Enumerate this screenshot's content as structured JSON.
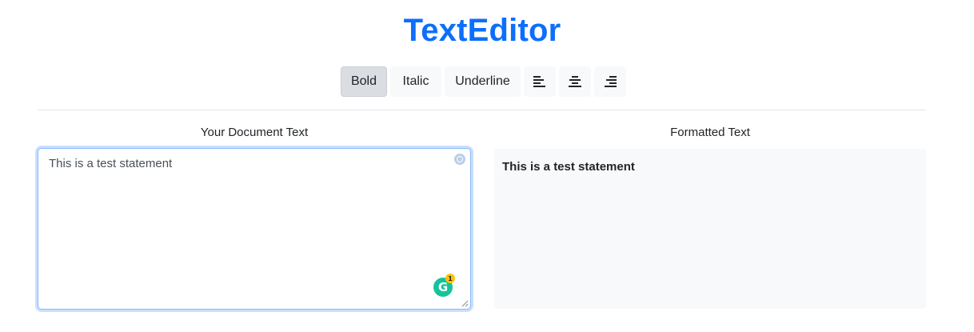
{
  "app": {
    "title": "TextEditor"
  },
  "toolbar": {
    "bold_label": "Bold",
    "italic_label": "Italic",
    "underline_label": "Underline",
    "align_left_icon": "align-left-icon",
    "align_center_icon": "align-center-icon",
    "align_right_icon": "align-right-icon",
    "active": "bold"
  },
  "editor": {
    "label": "Your Document Text",
    "value": "This is a test statement",
    "grammarly_count": "1"
  },
  "output": {
    "label": "Formatted Text",
    "text": "This is a test statement"
  },
  "colors": {
    "accent": "#0d6efd",
    "grammarly": "#15c39a",
    "output_bg": "#f8f9fa"
  }
}
